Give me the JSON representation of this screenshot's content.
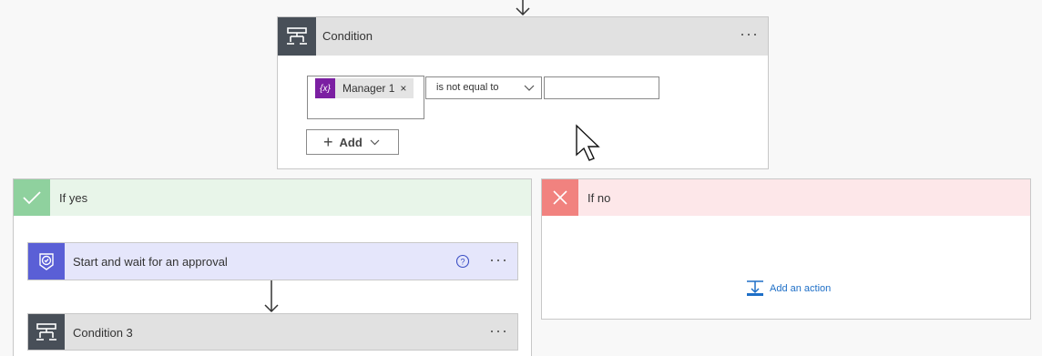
{
  "condition": {
    "title": "Condition",
    "more_label": "···",
    "token": {
      "label": "Manager 1",
      "icon_text": "{x}",
      "remove_label": "×"
    },
    "operator": {
      "value": "is not equal to"
    },
    "value_input": {
      "value": "",
      "placeholder": ""
    },
    "add_button": {
      "plus": "+",
      "label": "Add"
    }
  },
  "if_yes": {
    "title": "If yes",
    "actions": [
      {
        "title": "Start and wait for an approval",
        "help_icon": "question-circle-icon",
        "more_label": "···"
      },
      {
        "title": "Condition 3",
        "more_label": "···"
      }
    ]
  },
  "if_no": {
    "title": "If no",
    "add_action_label": "Add an action"
  },
  "colors": {
    "condition_icon_bg": "#484f58",
    "yes_icon_bg": "#8fd19e",
    "yes_header_bg": "#e8f5e9",
    "no_icon_bg": "#f1827f",
    "no_header_bg": "#fde7e9",
    "approval_icon_bg": "#5a5fd6",
    "approval_card_bg": "#e5e6fb",
    "token_icon_bg": "#7b1fa2",
    "link": "#1e6fc7"
  }
}
